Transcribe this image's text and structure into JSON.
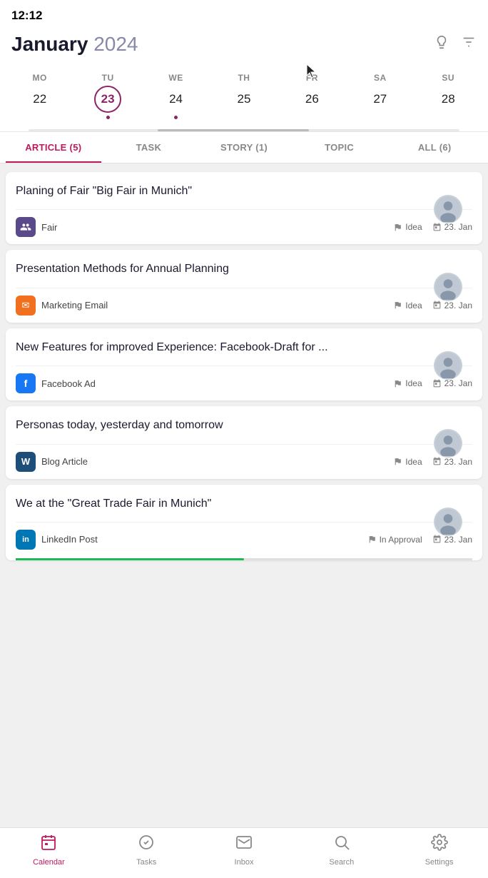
{
  "statusBar": {
    "time": "12:12"
  },
  "header": {
    "monthLabel": "January",
    "yearLabel": "2024",
    "lightbulbIcon": "💡",
    "filterIcon": "⚙"
  },
  "calendar": {
    "days": [
      {
        "label": "MO",
        "number": "22",
        "isToday": false,
        "hasDot": false
      },
      {
        "label": "TU",
        "number": "23",
        "isToday": true,
        "hasDot": true
      },
      {
        "label": "WE",
        "number": "24",
        "isToday": false,
        "hasDot": true
      },
      {
        "label": "TH",
        "number": "25",
        "isToday": false,
        "hasDot": false
      },
      {
        "label": "FR",
        "number": "26",
        "isToday": false,
        "hasDot": false
      },
      {
        "label": "SA",
        "number": "27",
        "isToday": false,
        "hasDot": false
      },
      {
        "label": "SU",
        "number": "28",
        "isToday": false,
        "hasDot": false
      }
    ]
  },
  "tabs": [
    {
      "id": "article",
      "label": "ARTICLE (5)",
      "active": true
    },
    {
      "id": "task",
      "label": "TASK",
      "active": false
    },
    {
      "id": "story",
      "label": "STORY (1)",
      "active": false
    },
    {
      "id": "topic",
      "label": "TOPIC",
      "active": false
    },
    {
      "id": "all",
      "label": "ALL (6)",
      "active": false
    }
  ],
  "cards": [
    {
      "id": "card-1",
      "title": "Planing of Fair \"Big Fair in Munich\"",
      "tagType": "fair",
      "tagLabel": "Fair",
      "tagEmoji": "👥",
      "statusIcon": "flag",
      "statusLabel": "Idea",
      "dateLabel": "23. Jan",
      "progressFill": 0,
      "hasProgress": false
    },
    {
      "id": "card-2",
      "title": "Presentation Methods for Annual Planning",
      "tagType": "marketing",
      "tagLabel": "Marketing Email",
      "tagEmoji": "✉",
      "statusIcon": "flag",
      "statusLabel": "Idea",
      "dateLabel": "23. Jan",
      "progressFill": 0,
      "hasProgress": false
    },
    {
      "id": "card-3",
      "title": "New Features for improved Experience: Facebook-Draft for ...",
      "tagType": "facebook",
      "tagLabel": "Facebook Ad",
      "tagEmoji": "f",
      "statusIcon": "flag",
      "statusLabel": "Idea",
      "dateLabel": "23. Jan",
      "progressFill": 0,
      "hasProgress": false
    },
    {
      "id": "card-4",
      "title": "Personas today, yesterday and tomorrow",
      "tagType": "wordpress",
      "tagLabel": "Blog Article",
      "tagEmoji": "W",
      "statusIcon": "flag",
      "statusLabel": "Idea",
      "dateLabel": "23. Jan",
      "progressFill": 0,
      "hasProgress": false
    },
    {
      "id": "card-5",
      "title": "We at the \"Great Trade Fair in Munich\"",
      "tagType": "linkedin",
      "tagLabel": "LinkedIn Post",
      "tagEmoji": "in",
      "statusIcon": "flag",
      "statusLabel": "In Approval",
      "dateLabel": "23. Jan",
      "progressFill": 50,
      "hasProgress": true
    }
  ],
  "bottomNav": [
    {
      "id": "calendar",
      "label": "Calendar",
      "icon": "calendar",
      "active": true
    },
    {
      "id": "tasks",
      "label": "Tasks",
      "icon": "tasks",
      "active": false
    },
    {
      "id": "inbox",
      "label": "Inbox",
      "icon": "inbox",
      "active": false
    },
    {
      "id": "search",
      "label": "Search",
      "icon": "search",
      "active": false
    },
    {
      "id": "settings",
      "label": "Settings",
      "icon": "settings",
      "active": false
    }
  ]
}
